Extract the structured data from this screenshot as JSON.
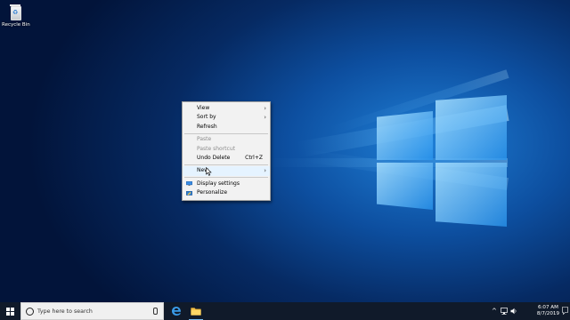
{
  "desktop": {
    "recycle_bin_label": "Recycle Bin"
  },
  "context_menu": {
    "items": [
      {
        "label": "View",
        "submenu": true
      },
      {
        "label": "Sort by",
        "submenu": true
      },
      {
        "label": "Refresh"
      },
      {
        "label": "Paste",
        "disabled": true
      },
      {
        "label": "Paste shortcut",
        "disabled": true
      },
      {
        "label": "Undo Delete",
        "shortcut": "Ctrl+Z"
      },
      {
        "label": "New",
        "submenu": true,
        "hovered": true
      },
      {
        "label": "Display settings",
        "icon": "display-settings-icon"
      },
      {
        "label": "Personalize",
        "icon": "personalize-icon"
      }
    ]
  },
  "taskbar": {
    "search_placeholder": "Type here to search",
    "time": "6:07 AM",
    "date": "8/7/2019"
  },
  "colors": {
    "accent": "#0078d7",
    "taskbar": "#101a2a"
  }
}
